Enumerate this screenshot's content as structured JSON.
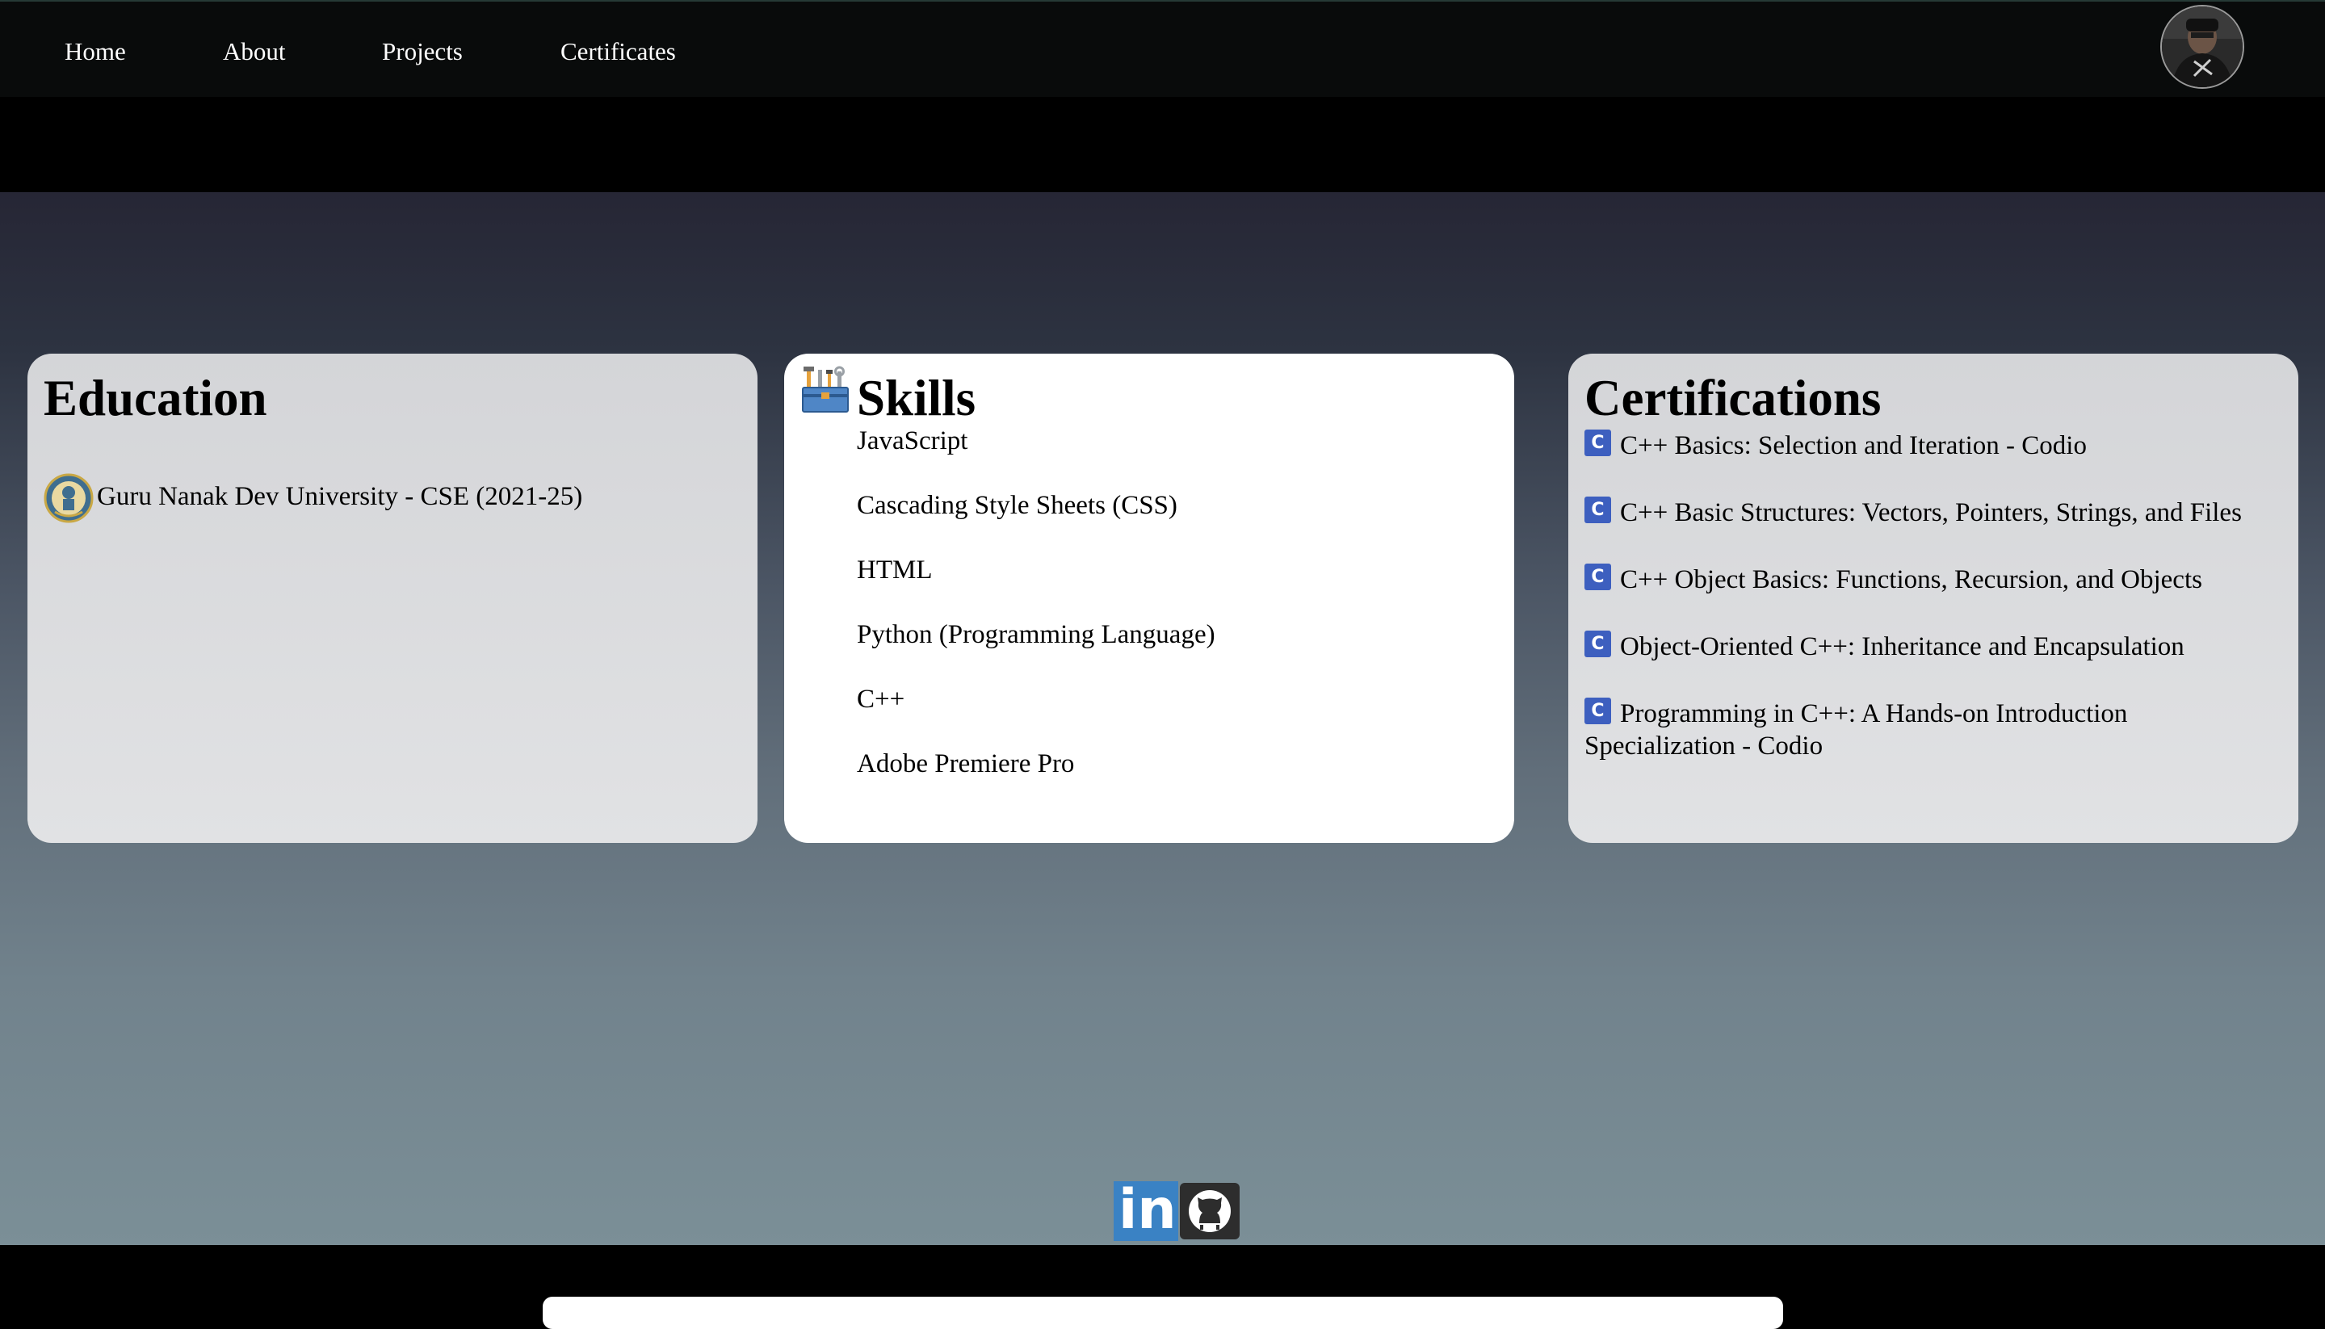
{
  "nav": {
    "links": [
      "Home",
      "About",
      "Projects",
      "Certificates"
    ]
  },
  "education": {
    "title": "Education",
    "items": [
      "Guru Nanak Dev University - CSE (2021-25)"
    ]
  },
  "skills": {
    "title": "Skills",
    "items": [
      "JavaScript",
      "Cascading Style Sheets (CSS)",
      "HTML",
      "Python (Programming Language)",
      "C++",
      "Adobe Premiere Pro"
    ]
  },
  "certifications": {
    "title": "Certifications",
    "items": [
      "C++ Basics: Selection and Iteration - Codio",
      "C++ Basic Structures: Vectors, Pointers, Strings, and Files",
      "C++ Object Basics: Functions, Recursion, and Objects",
      "Object-Oriented C++: Inheritance and Encapsulation",
      "Programming in C++: A Hands-on Introduction",
      "Specialization - Codio"
    ]
  },
  "socials": {
    "linkedin_icon": "linkedin-icon",
    "github_icon": "github-icon",
    "linkedin_text": "in"
  },
  "colors": {
    "nav_bg": "#090b0b",
    "linkedin": "#3a82c4",
    "github_bg": "#2d2d2d",
    "cert_icon": "#3d5fbf"
  }
}
